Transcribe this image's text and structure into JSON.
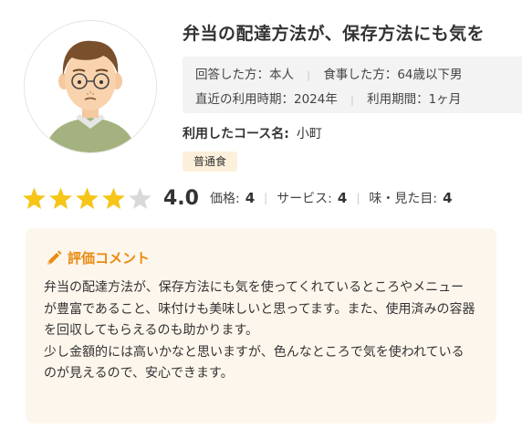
{
  "review": {
    "title": "弁当の配達方法が、保存方法にも気を",
    "meta": {
      "respondent_label": "回答した方：",
      "respondent_value": "本人",
      "eater_label": "食事した方：",
      "eater_value": "64歳以下男",
      "recent_label": "直近の利用時期：",
      "recent_value": "2024年",
      "period_label": "利用期間：",
      "period_value": "1ヶ月"
    },
    "course_label": "利用したコース名:",
    "course_value": "小町",
    "badge": "普通食",
    "rating": {
      "stars_filled": 4,
      "stars_total": 5,
      "score": "4.0",
      "price_label": "価格:",
      "price_value": "4",
      "service_label": "サービス:",
      "service_value": "4",
      "taste_label": "味・見た目:",
      "taste_value": "4"
    },
    "comment": {
      "heading": "評価コメント",
      "icon": "pencil-icon",
      "body": "弁当の配達方法が、保存方法にも気を使ってくれているところやメニューが豊富であること、味付けも美味しいと思ってます。また、使用済みの容器を回収してもらえるのも助かります。\n少し金額的には高いかなと思いますが、色んなところで気を使われているのが見えるので、安心できます。"
    }
  },
  "colors": {
    "star_filled": "#f5c518",
    "star_empty": "#d9d9d9",
    "accent_orange": "#ea8a10",
    "comment_bg": "#fdf6ec",
    "badge_bg": "#fdf0db",
    "meta_bg": "#f3f3f3"
  }
}
